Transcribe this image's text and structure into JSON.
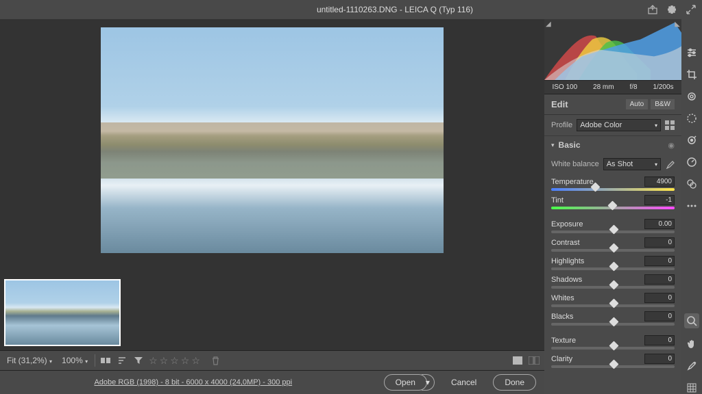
{
  "title": "untitled-1110263.DNG  -  LEICA Q (Typ 116)",
  "exif": {
    "iso": "ISO 100",
    "focal": "28 mm",
    "aperture": "f/8",
    "shutter": "1/200s"
  },
  "edit": {
    "header": "Edit",
    "auto": "Auto",
    "bw": "B&W",
    "profile_label": "Profile",
    "profile_value": "Adobe Color",
    "basic_label": "Basic",
    "wb_label": "White balance",
    "wb_value": "As Shot",
    "sliders": {
      "temperature": {
        "label": "Temperature",
        "value": "4900",
        "pos": 35
      },
      "tint": {
        "label": "Tint",
        "value": "-1",
        "pos": 49
      },
      "exposure": {
        "label": "Exposure",
        "value": "0.00",
        "pos": 50
      },
      "contrast": {
        "label": "Contrast",
        "value": "0",
        "pos": 50
      },
      "highlights": {
        "label": "Highlights",
        "value": "0",
        "pos": 50
      },
      "shadows": {
        "label": "Shadows",
        "value": "0",
        "pos": 50
      },
      "whites": {
        "label": "Whites",
        "value": "0",
        "pos": 50
      },
      "blacks": {
        "label": "Blacks",
        "value": "0",
        "pos": 50
      },
      "texture": {
        "label": "Texture",
        "value": "0",
        "pos": 50
      },
      "clarity": {
        "label": "Clarity",
        "value": "0",
        "pos": 50
      }
    }
  },
  "viewbar": {
    "fit": "Fit (31,2%)",
    "zoom": "100%"
  },
  "footer": {
    "info": "Adobe RGB (1998) - 8 bit - 6000 x 4000 (24,0MP) - 300 ppi",
    "open": "Open",
    "cancel": "Cancel",
    "done": "Done"
  }
}
